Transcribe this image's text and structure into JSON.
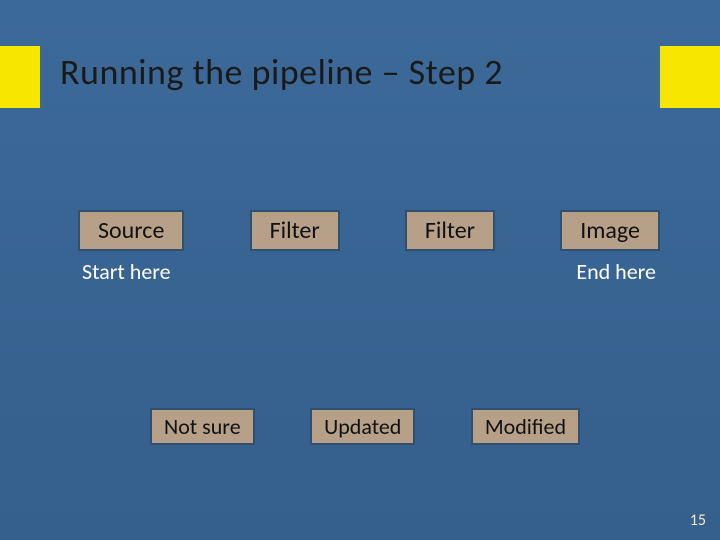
{
  "title": "Running the pipeline – Step 2",
  "row1": {
    "b1": "Source",
    "b2": "Filter",
    "b3": "Filter",
    "b4": "Image"
  },
  "labels": {
    "start": "Start here",
    "end": "End here"
  },
  "row2": {
    "b1": "Not sure",
    "b2": "Updated",
    "b3": "Modified"
  },
  "page_number": "15"
}
